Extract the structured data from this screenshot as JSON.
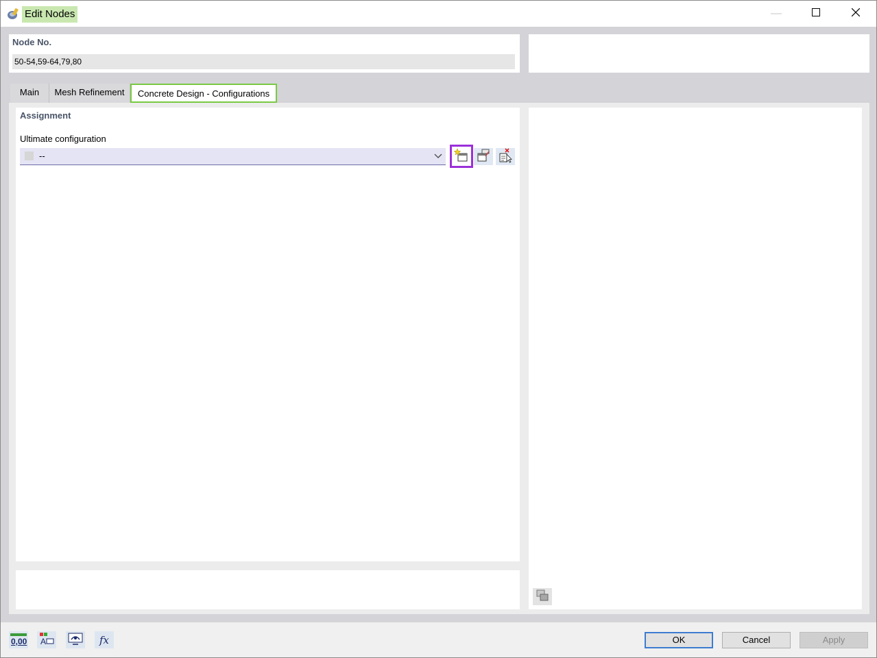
{
  "window": {
    "title": "Edit Nodes",
    "minimize_glyph": "—",
    "maximize_glyph": "☐",
    "close_glyph": "✕"
  },
  "node": {
    "label": "Node No.",
    "value": "50-54,59-64,79,80"
  },
  "tabs": [
    {
      "label": "Main",
      "active": false
    },
    {
      "label": "Mesh Refinement",
      "active": false
    },
    {
      "label": "Concrete Design - Configurations",
      "active": true
    }
  ],
  "assignment": {
    "section_label": "Assignment",
    "ultimate_label": "Ultimate configuration",
    "ultimate_value": "--",
    "buttons": [
      "new-configuration-icon",
      "edit-configuration-icon",
      "select-from-model-icon"
    ]
  },
  "footer": {
    "icons": [
      "units-decimals-icon",
      "text-attributes-icon",
      "view-options-icon",
      "formula-icon"
    ],
    "units_text": "0,00",
    "formula_text": "fx",
    "ok": "OK",
    "cancel": "Cancel",
    "apply": "Apply"
  },
  "colors": {
    "title_highlight": "#c9e8b0",
    "active_tab_border": "#7ac943",
    "highlight_button_border": "#9b30d9",
    "primary_button_border": "#3c7bd0"
  }
}
